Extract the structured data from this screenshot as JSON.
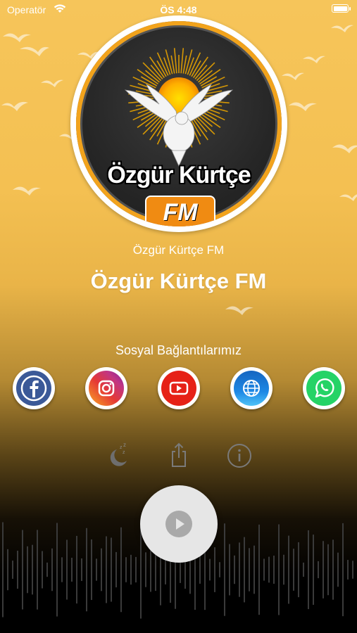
{
  "status_bar": {
    "carrier": "Operatör",
    "time": "ÖS 4:48"
  },
  "logo": {
    "name_text": "Özgür Kürtçe",
    "fm_text": "FM"
  },
  "station": {
    "subtitle": "Özgür Kürtçe FM",
    "title": "Özgür Kürtçe FM"
  },
  "social": {
    "heading": "Sosyal Bağlantılarımız",
    "links": [
      {
        "icon": "facebook-icon",
        "color": "#3b5998"
      },
      {
        "icon": "instagram-icon",
        "color": "#c13584"
      },
      {
        "icon": "youtube-icon",
        "color": "#e62117"
      },
      {
        "icon": "globe-icon",
        "color": "#1e88e5"
      },
      {
        "icon": "whatsapp-icon",
        "color": "#25d366"
      }
    ]
  },
  "toolbar": {
    "sleep_icon": "sleep-timer-icon",
    "share_icon": "share-icon",
    "info_icon": "info-icon"
  },
  "player": {
    "state": "paused",
    "play_icon": "play-icon"
  }
}
